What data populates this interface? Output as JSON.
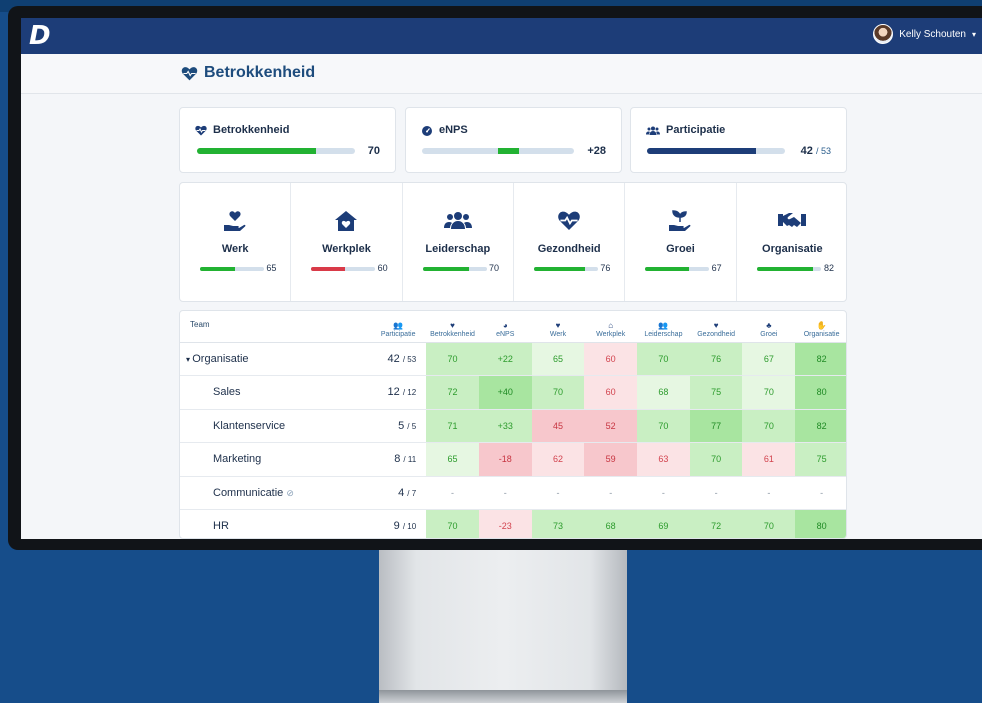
{
  "app": {
    "logo": "D",
    "user_name": "Kelly Schouten",
    "caret": "▾"
  },
  "page": {
    "title": "Betrokkenheid",
    "icon": "heart-pulse-icon"
  },
  "kpis": [
    {
      "label": "Betrokkenheid",
      "icon": "heart-pulse-icon",
      "value": "70",
      "fill_pct": 75
    },
    {
      "label": "eNPS",
      "icon": "gauge-icon",
      "value": "+28",
      "fill_start_pct": 50,
      "fill_pct": 14
    },
    {
      "label": "Participatie",
      "icon": "users-icon",
      "value": "42",
      "value_total": "/ 53",
      "fill_pct": 79
    }
  ],
  "categories": [
    {
      "label": "Werk",
      "icon": "hand-heart-icon",
      "value": "65",
      "fill_pct": 55,
      "color": "#22b232"
    },
    {
      "label": "Werkplek",
      "icon": "house-heart-icon",
      "value": "60",
      "fill_pct": 52,
      "color": "#d93a48"
    },
    {
      "label": "Leiderschap",
      "icon": "users-icon",
      "value": "70",
      "fill_pct": 72,
      "color": "#22b232"
    },
    {
      "label": "Gezondheid",
      "icon": "heart-pulse-icon",
      "value": "76",
      "fill_pct": 80,
      "color": "#22b232"
    },
    {
      "label": "Groei",
      "icon": "hand-sprout-icon",
      "value": "67",
      "fill_pct": 68,
      "color": "#22b232"
    },
    {
      "label": "Organisatie",
      "icon": "handshake-icon",
      "value": "82",
      "fill_pct": 88,
      "color": "#22b232"
    }
  ],
  "table": {
    "headers": [
      "Team",
      "Participatie",
      "Betrokkenheid",
      "eNPS",
      "Werk",
      "Werkplek",
      "Leiderschap",
      "Gezondheid",
      "Groei",
      "Organisatie"
    ],
    "rows": [
      {
        "name": "Organisatie",
        "root": true,
        "part": "42",
        "total": "/ 53",
        "cells": [
          "70",
          "+22",
          "65",
          "60",
          "70",
          "76",
          "67",
          "82"
        ],
        "tones": [
          "g2",
          "g2",
          "g1",
          "r1",
          "g2",
          "g2",
          "g1",
          "g3"
        ]
      },
      {
        "name": "Sales",
        "part": "12",
        "total": "/ 12",
        "cells": [
          "72",
          "+40",
          "70",
          "60",
          "68",
          "75",
          "70",
          "80"
        ],
        "tones": [
          "g2",
          "g3",
          "g2",
          "r1",
          "g1",
          "g2",
          "g1",
          "g3"
        ]
      },
      {
        "name": "Klantenservice",
        "part": "5",
        "total": "/ 5",
        "cells": [
          "71",
          "+33",
          "45",
          "52",
          "70",
          "77",
          "70",
          "82"
        ],
        "tones": [
          "g2",
          "g2",
          "r2",
          "r2",
          "g2",
          "g3",
          "g2",
          "g3"
        ]
      },
      {
        "name": "Marketing",
        "part": "8",
        "total": "/ 11",
        "cells": [
          "65",
          "-18",
          "62",
          "59",
          "63",
          "70",
          "61",
          "75"
        ],
        "tones": [
          "g1",
          "r2",
          "r1",
          "r2",
          "r1",
          "g2",
          "r1",
          "g2"
        ]
      },
      {
        "name": "Communicatie",
        "hidden_icon": "eye-slash-icon",
        "part": "4",
        "total": "/ 7",
        "cells": [
          "-",
          "-",
          "-",
          "-",
          "-",
          "-",
          "-",
          "-"
        ],
        "tones": [
          "n0",
          "n0",
          "n0",
          "n0",
          "n0",
          "n0",
          "n0",
          "n0"
        ]
      },
      {
        "name": "HR",
        "part": "9",
        "total": "/ 10",
        "cells": [
          "70",
          "-23",
          "73",
          "68",
          "69",
          "72",
          "70",
          "80"
        ],
        "tones": [
          "g2",
          "r1",
          "g2",
          "g2",
          "g2",
          "g2",
          "g2",
          "g3"
        ]
      }
    ]
  },
  "colors": {
    "navy": "#1d3d78",
    "green": "#22b232",
    "red": "#d93a48",
    "participation_bar": "#1d3d78"
  }
}
